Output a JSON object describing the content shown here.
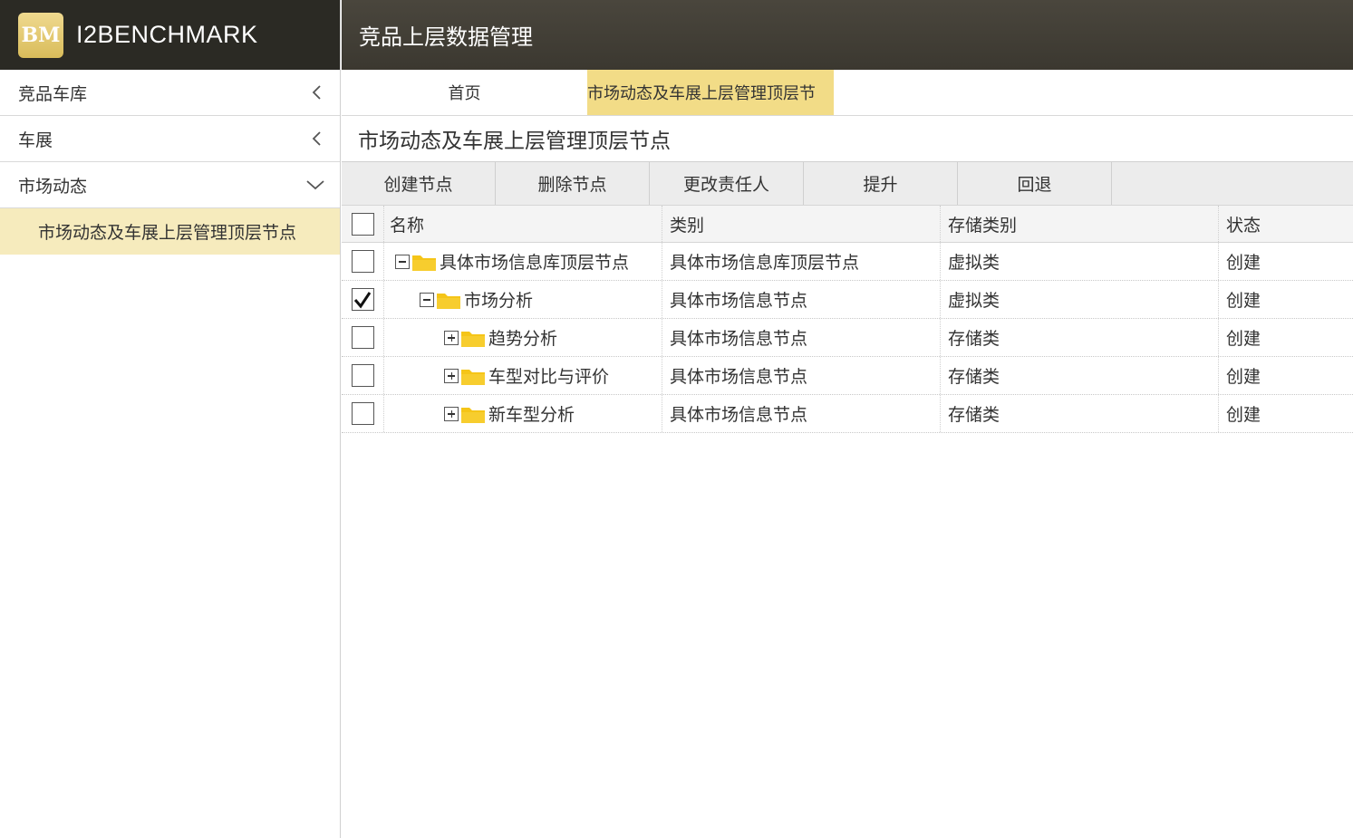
{
  "brand": {
    "logo_mark": "BM",
    "name": "I2BENCHMARK"
  },
  "header": {
    "title": "竞品上层数据管理"
  },
  "sidebar": {
    "items": [
      {
        "label": "竞品车库",
        "icon": "chevron-left-icon"
      },
      {
        "label": "车展",
        "icon": "chevron-left-icon"
      },
      {
        "label": "市场动态",
        "icon": "chevron-down-icon"
      }
    ],
    "sub_items": [
      {
        "label": "市场动态及车展上层管理顶层节点",
        "selected": true
      }
    ]
  },
  "tabs": [
    {
      "label": "首页",
      "active": false
    },
    {
      "label": "市场动态及车展上层管理顶层节",
      "active": true
    }
  ],
  "page_title": "市场动态及车展上层管理顶层节点",
  "toolbar": {
    "create_label": "创建节点",
    "delete_label": "删除节点",
    "change_owner_label": "更改责任人",
    "promote_label": "提升",
    "rollback_label": "回退"
  },
  "grid": {
    "headers": {
      "name": "名称",
      "type": "类别",
      "storage": "存储类别",
      "status": "状态"
    },
    "rows": [
      {
        "name": "具体市场信息库顶层节点",
        "type": "具体市场信息库顶层节点",
        "storage": "虚拟类",
        "status": "创建",
        "checked": false,
        "expanded": true,
        "level": 0
      },
      {
        "name": "市场分析",
        "type": "具体市场信息节点",
        "storage": "虚拟类",
        "status": "创建",
        "checked": true,
        "expanded": true,
        "level": 1
      },
      {
        "name": "趋势分析",
        "type": "具体市场信息节点",
        "storage": "存储类",
        "status": "创建",
        "checked": false,
        "expanded": false,
        "level": 2
      },
      {
        "name": "车型对比与评价",
        "type": "具体市场信息节点",
        "storage": "存储类",
        "status": "创建",
        "checked": false,
        "expanded": false,
        "level": 2
      },
      {
        "name": "新车型分析",
        "type": "具体市场信息节点",
        "storage": "存储类",
        "status": "创建",
        "checked": false,
        "expanded": false,
        "level": 2
      }
    ]
  },
  "colors": {
    "accent": "#f2dc87",
    "sidebar_selected": "#f6ebbd",
    "header_dark": "#3b3830",
    "folder": "#f5c518"
  }
}
